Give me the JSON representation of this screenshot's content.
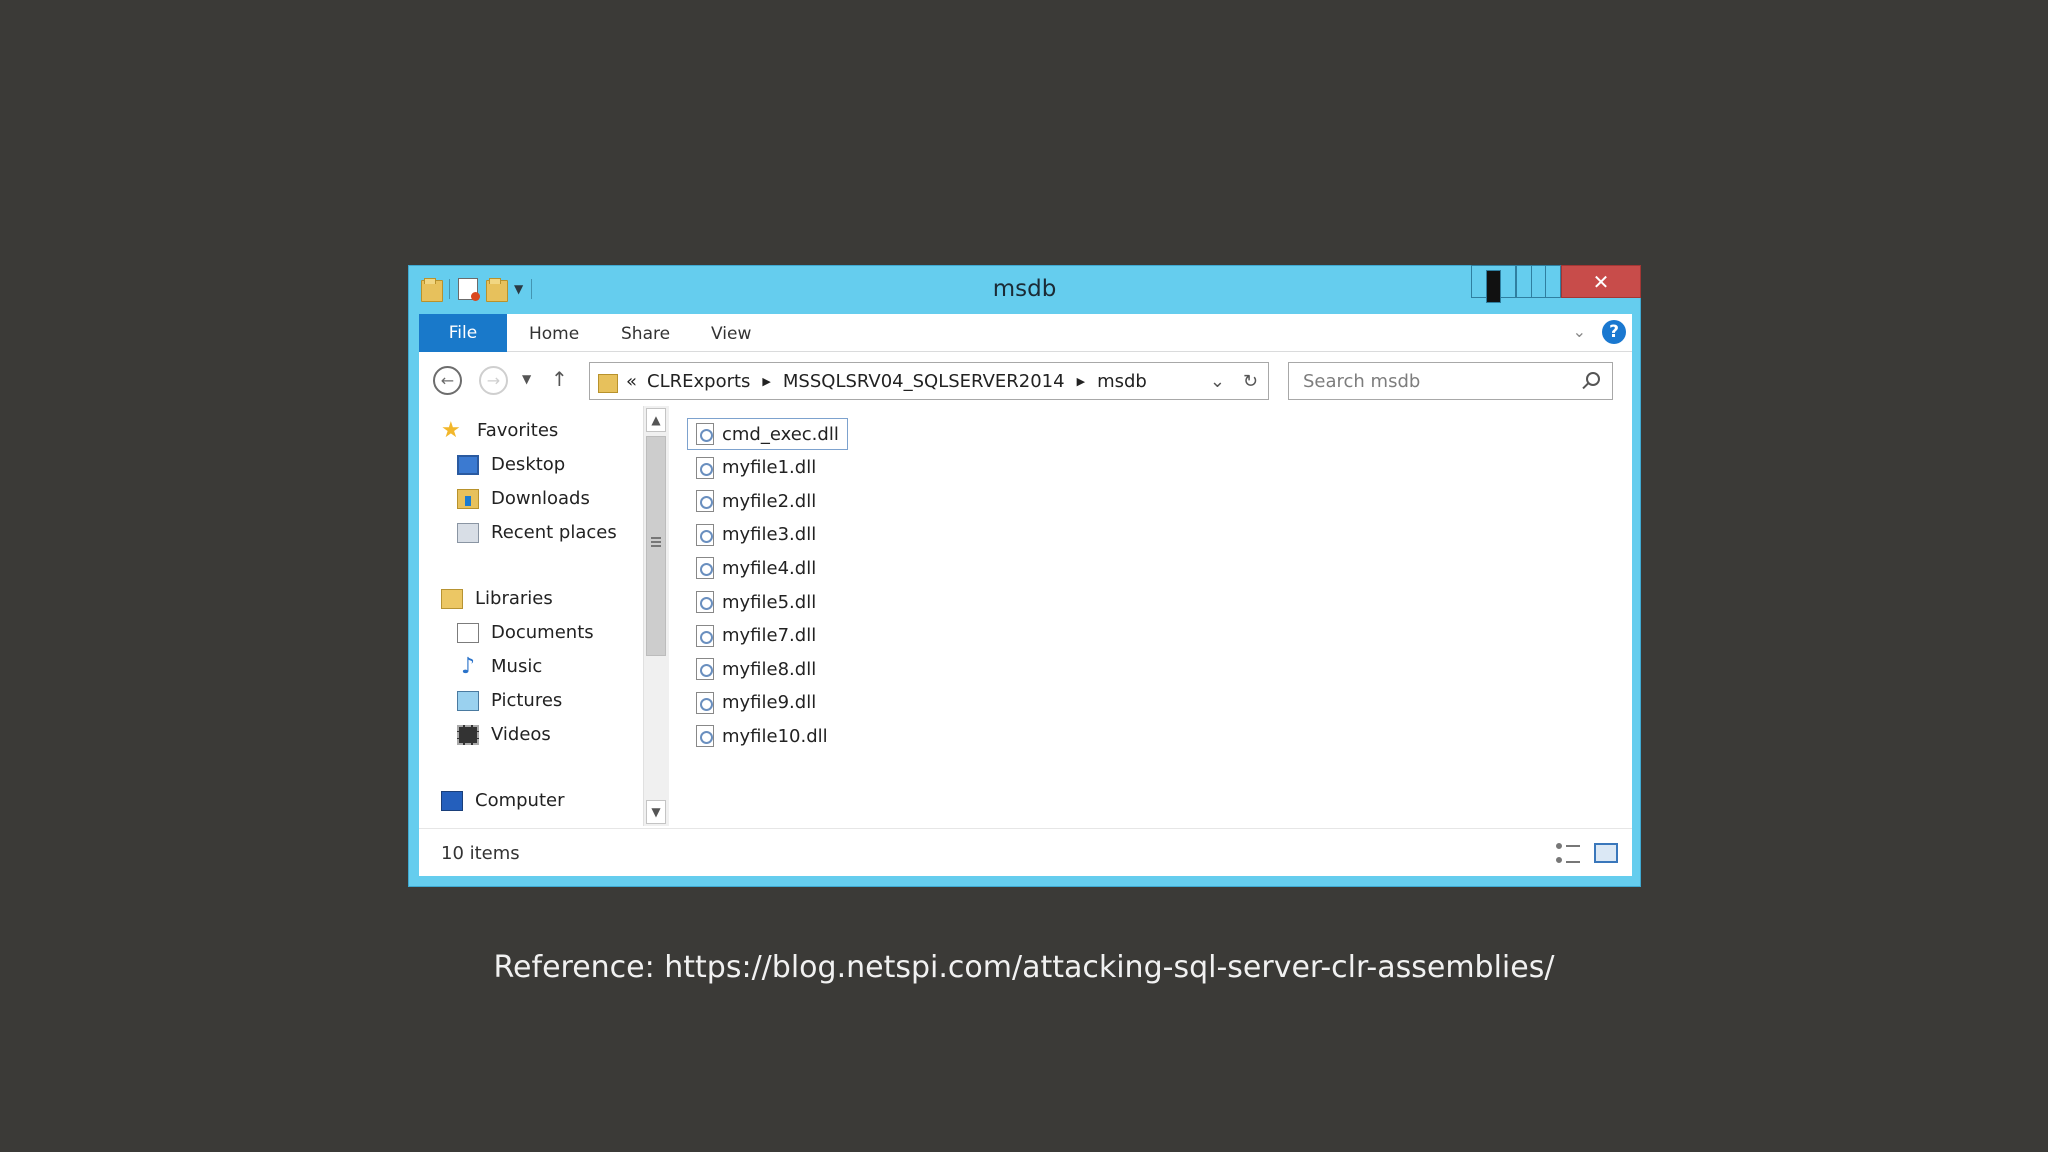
{
  "window": {
    "title": "msdb",
    "controls": {
      "minimize": "minimize-icon",
      "maximize": "maximize-icon",
      "close": "close-icon"
    },
    "close_color": "#c84c4a",
    "frame_color": "#65cdee"
  },
  "ribbon": {
    "tabs": [
      "File",
      "Home",
      "Share",
      "View"
    ],
    "active_tab": "File",
    "active_color": "#1979ca"
  },
  "address": {
    "prefix": "«",
    "crumbs": [
      "CLRExports",
      "MSSQLSRV04_SQLSERVER2014",
      "msdb"
    ]
  },
  "search": {
    "placeholder": "Search msdb"
  },
  "nav": {
    "favorites": {
      "label": "Favorites",
      "items": [
        "Desktop",
        "Downloads",
        "Recent places"
      ]
    },
    "libraries": {
      "label": "Libraries",
      "items": [
        "Documents",
        "Music",
        "Pictures",
        "Videos"
      ]
    },
    "computer": {
      "label": "Computer"
    }
  },
  "files": [
    "cmd_exec.dll",
    "myfile1.dll",
    "myfile2.dll",
    "myfile3.dll",
    "myfile4.dll",
    "myfile5.dll",
    "myfile7.dll",
    "myfile8.dll",
    "myfile9.dll",
    "myfile10.dll"
  ],
  "selected_file": "cmd_exec.dll",
  "status": {
    "item_count": "10 items"
  },
  "reference": "Reference: https://blog.netspi.com/attacking-sql-server-clr-assemblies/"
}
